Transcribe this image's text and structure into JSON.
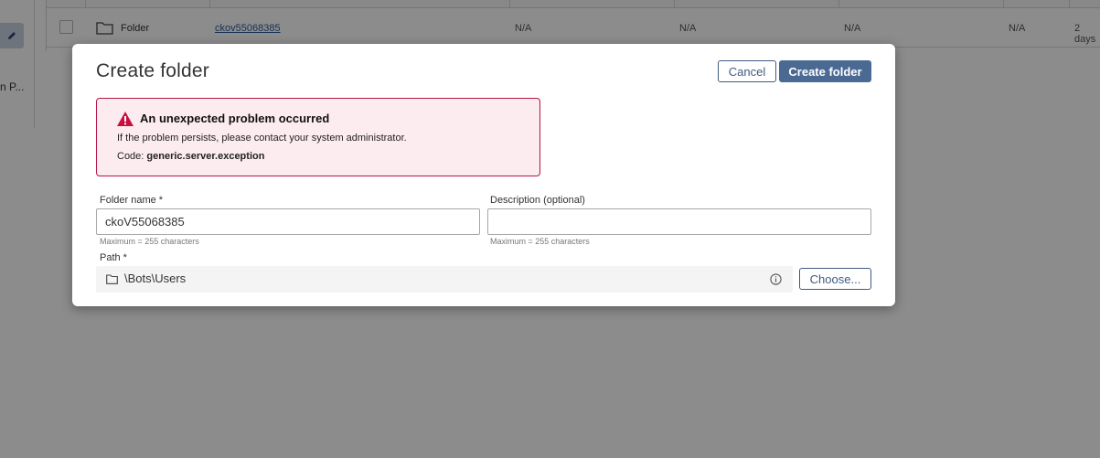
{
  "background": {
    "side_text": "n P...",
    "row": {
      "type": "Folder",
      "name": "ckov55068385",
      "cells": [
        "N/A",
        "N/A",
        "N/A",
        "N/A"
      ],
      "last": "2 days"
    }
  },
  "modal": {
    "title": "Create folder",
    "cancel_label": "Cancel",
    "create_label": "Create folder",
    "alert": {
      "title": "An unexpected problem occurred",
      "line1": "If the problem persists, please contact your system administrator.",
      "code_prefix": "Code:",
      "code_value": "generic.server.exception",
      "icon": "warning-triangle-icon",
      "border_color": "#b4134a",
      "background_color": "#fdecef"
    },
    "folder_name": {
      "label": "Folder name *",
      "value": "ckoV55068385",
      "hint": "Maximum = 255 characters"
    },
    "description": {
      "label": "Description (optional)",
      "value": "",
      "hint": "Maximum = 255 characters"
    },
    "path": {
      "label": "Path *",
      "value": "\\Bots\\Users",
      "choose_label": "Choose..."
    }
  },
  "colors": {
    "accent": "#4a6a94",
    "link": "#2b5a9c",
    "error": "#b4134a"
  }
}
